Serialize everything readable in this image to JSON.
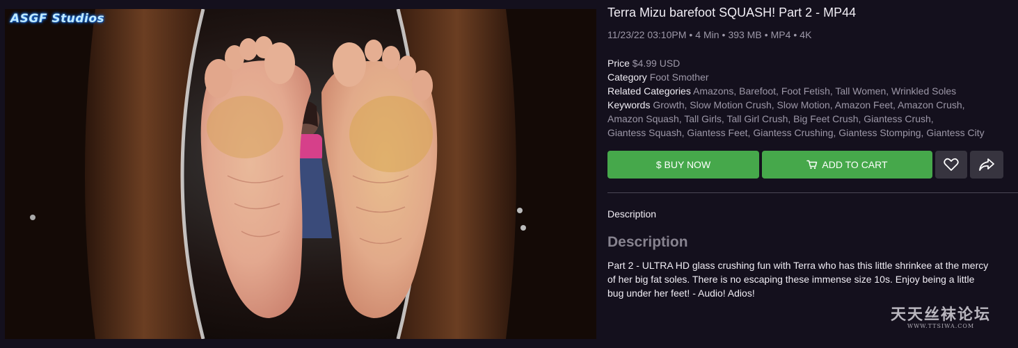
{
  "media": {
    "studio_logo": "ASGF Studios"
  },
  "product": {
    "title": "Terra Mizu barefoot SQUASH! Part 2 - MP44",
    "meta": [
      "11/23/22 03:10PM",
      "4 Min",
      "393 MB",
      "MP4",
      "4K"
    ],
    "price_label": "Price",
    "price_value": "$4.99 USD",
    "category_label": "Category",
    "category_value": "Foot Smother",
    "related_label": "Related Categories",
    "related_value": "Amazons, Barefoot, Foot Fetish, Tall Women, Wrinkled Soles",
    "keywords_label": "Keywords",
    "keywords_line1": "Growth, Slow Motion Crush, Slow Motion, Amazon Feet, Amazon Crush,",
    "keywords_line2": "Amazon Squash, Tall Girls, Tall Girl Crush, Big Feet Crush, Giantess Crush,",
    "keywords_line3": "Giantess Squash, Giantess Feet, Giantess Crushing, Giantess Stomping, Giantess City"
  },
  "buttons": {
    "buy_now": "$ BUY NOW",
    "add_to_cart": "ADD TO CART",
    "favorite_icon": "heart-icon",
    "share_icon": "share-arrow-icon",
    "cart_icon": "cart-icon"
  },
  "description": {
    "tab_label": "Description",
    "heading": "Description",
    "line1": "Part 2 - ULTRA HD glass crushing fun with Terra who has this little shrinkee at the mercy",
    "line2": "of her big fat soles. There is no escaping these immense size 10s. Enjoy being a little",
    "line3": "bug under her feet! - Audio! Adios!"
  },
  "watermark": {
    "main": "天天丝袜论坛",
    "sub": "WWW.TTSIWA.COM"
  },
  "colors": {
    "background": "#14101d",
    "green_button": "#46a84b",
    "dark_button": "#37343f",
    "muted_text": "#9d98a8",
    "heading_gray": "#87838f"
  }
}
